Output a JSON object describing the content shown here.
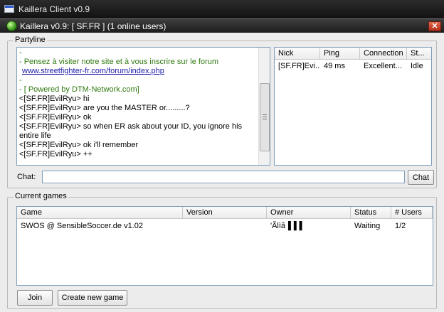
{
  "outer_window": {
    "title": "Kaillera Client v0.9"
  },
  "window": {
    "title": "Kaillera v0.9: [ SF.FR ] (1 online users)",
    "close_symbol": "✕"
  },
  "partyline": {
    "label": "Partyline",
    "lines": [
      {
        "text": "-",
        "style": "green"
      },
      {
        "text": "- Pensez à visiter notre site et à vous inscrire sur le forum",
        "style": "green"
      },
      {
        "text": "www.streetfighter-fr.com/forum/index.php",
        "style": "link"
      },
      {
        "text": "-",
        "style": "green"
      },
      {
        "text": "- [ Powered by DTM-Network.com]",
        "style": "green"
      },
      {
        "text": "<[SF.FR]EvilRyu> hi",
        "style": "normal"
      },
      {
        "text": "<[SF.FR]EvilRyu> are you the MASTER or.........?",
        "style": "normal"
      },
      {
        "text": "<[SF.FR]EvilRyu> ok",
        "style": "normal"
      },
      {
        "text": "<[SF.FR]EvilRyu> so when ER ask about your ID, you ignore his entire life",
        "style": "normal"
      },
      {
        "text": "<[SF.FR]EvilRyu> ok i'll remember",
        "style": "normal"
      },
      {
        "text": "<[SF.FR]EvilRyu> ++",
        "style": "normal"
      }
    ],
    "users_headers": [
      "Nick",
      "Ping",
      "Connection",
      "St..."
    ],
    "users": [
      {
        "nick": "[SF.FR]Evi...",
        "ping": "49 ms",
        "connection": "Excellent...",
        "status": "Idle"
      }
    ],
    "chat_label": "Chat:",
    "chat_value": "",
    "chat_button": "Chat"
  },
  "current_games": {
    "label": "Current games",
    "headers": [
      "Game",
      "Version",
      "Owner",
      "Status",
      "# Users"
    ],
    "rows": [
      {
        "game": "SWOS @ SensibleSoccer.de v1.02",
        "version": "",
        "owner": "'Ãlìã▐▐▐",
        "status": "Waiting",
        "users": "1/2"
      }
    ],
    "join_button": "Join",
    "create_button": "Create new game"
  },
  "colors": {
    "partyline_green": "#2f7a10",
    "link_blue": "#1a1aa8"
  }
}
